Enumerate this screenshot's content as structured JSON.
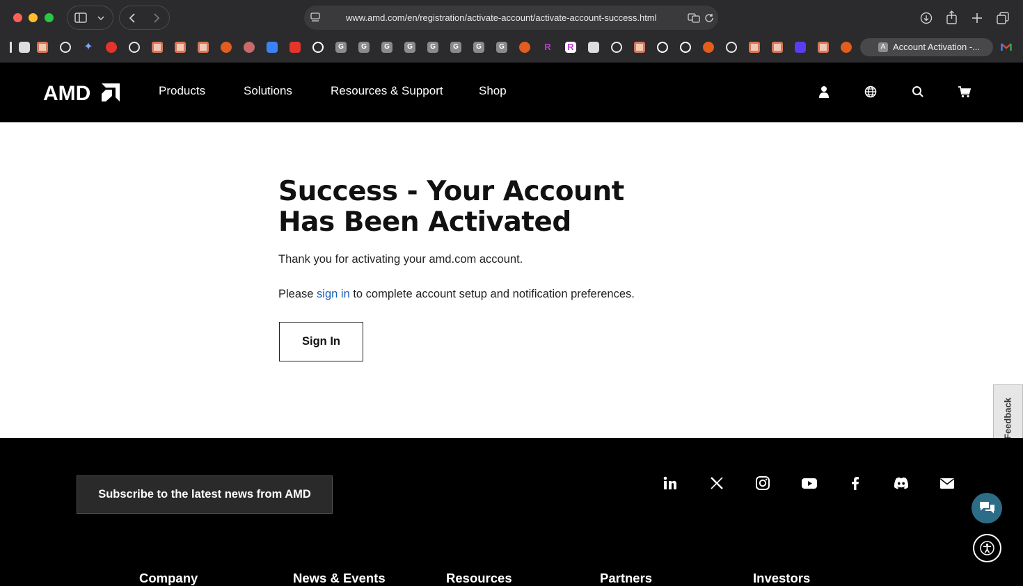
{
  "browser": {
    "url": "www.amd.com/en/registration/activate-account/activate-account-success.html",
    "active_tab_title": "Account Activation -...",
    "active_tab_letter": "A",
    "bookmark_letter": "G"
  },
  "nav": {
    "logo": "AMD",
    "links": [
      "Products",
      "Solutions",
      "Resources & Support",
      "Shop"
    ]
  },
  "main": {
    "title_line1": "Success - Your Account",
    "title_line2": "Has Been Activated",
    "thanks": "Thank you for activating your amd.com account.",
    "please_prefix": "Please ",
    "signin_link": "sign in",
    "please_suffix": " to complete account setup and notification preferences.",
    "signin_button": "Sign In"
  },
  "feedback": "Feedback",
  "footer": {
    "subscribe": "Subscribe to the latest news from AMD",
    "headings": [
      "Company",
      "News & Events",
      "Resources",
      "Partners",
      "Investors"
    ]
  },
  "colors": {
    "link": "#1a5fb4",
    "chat": "#2d6c86"
  }
}
